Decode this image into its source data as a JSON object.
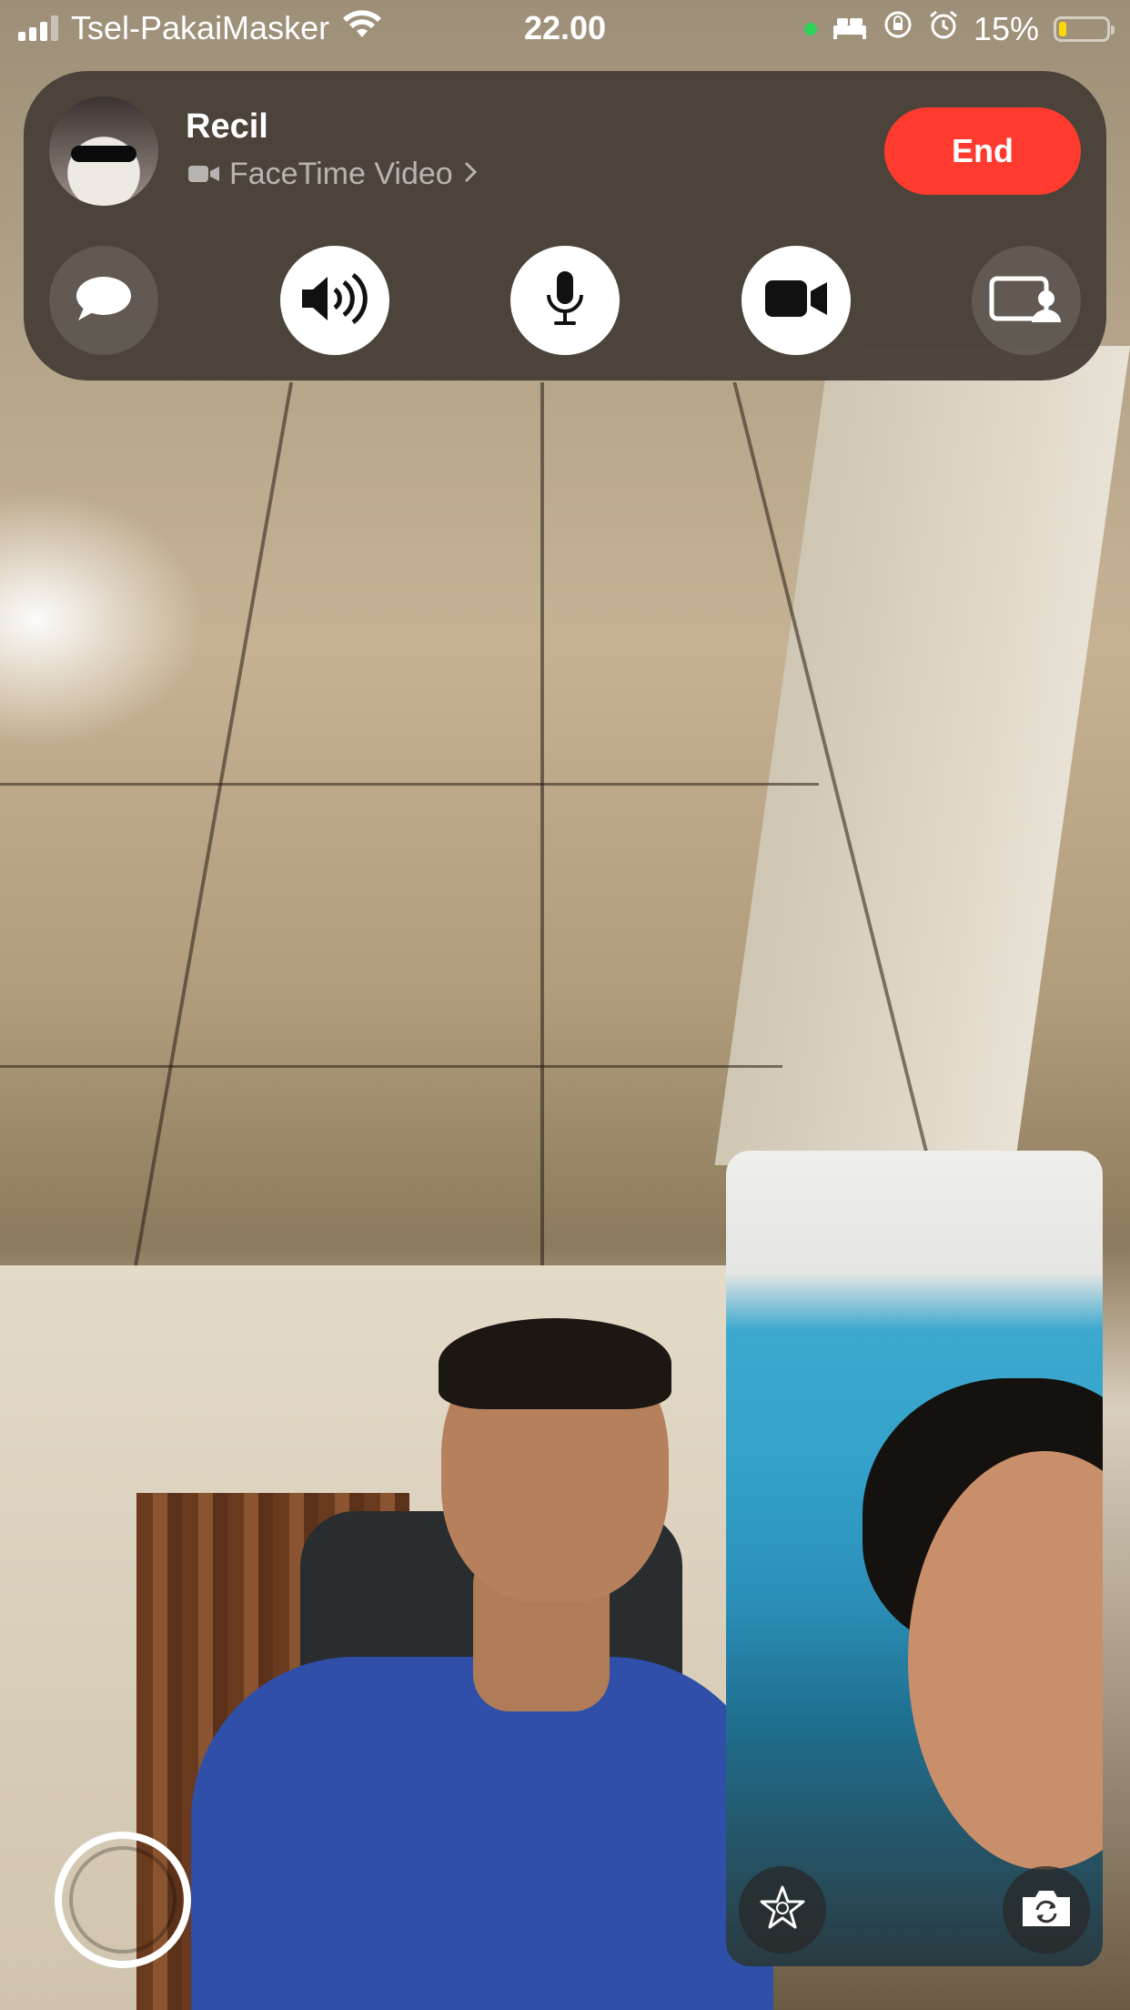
{
  "status_bar": {
    "carrier": "Tsel-PakaiMasker",
    "time": "22.00",
    "battery": "15%",
    "battery_level": 0.15,
    "icons": [
      "signal-icon",
      "wifi-icon",
      "camera-indicator-dot",
      "sleep-bed-icon",
      "rotation-lock-icon",
      "alarm-icon",
      "battery-icon"
    ]
  },
  "call": {
    "caller_name": "Recil",
    "call_type": "FaceTime Video",
    "end_label": "End"
  },
  "controls": [
    "message-icon",
    "speaker-icon",
    "microphone-icon",
    "video-camera-icon",
    "shareplay-icon"
  ],
  "colors": {
    "end": "#ff3b30",
    "panel": "#484038",
    "camera_indicator": "#30d158",
    "battery_low": "#ffd60a"
  }
}
